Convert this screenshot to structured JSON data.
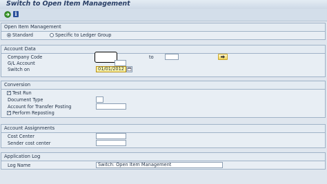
{
  "window": {
    "title": "Switch to Open Item Management"
  },
  "toolbar": {
    "execute_icon": "execute-icon",
    "info_label": "i"
  },
  "open_item_management": {
    "title": "Open Item Management",
    "options": [
      {
        "label": "Standard",
        "selected": true
      },
      {
        "label": "Specific to Ledger Group",
        "selected": false
      }
    ]
  },
  "account_data": {
    "title": "Account Data",
    "company_code_label": "Company Code",
    "company_code_value": "",
    "to_label": "to",
    "to_value": "",
    "gl_account_label": "G/L Account",
    "gl_account_value": "",
    "switch_on_label": "Switch on",
    "switch_on_value": "01/01/2012"
  },
  "conversion": {
    "title": "Conversion",
    "test_run_label": "Test Run",
    "test_run_checked": true,
    "document_type_label": "Document Type",
    "document_type_value": "",
    "transfer_account_label": "Account for Transfer Posting",
    "transfer_account_value": "",
    "perform_reposting_label": "Perform Reposting",
    "perform_reposting_checked": true,
    "check_mark": "✓"
  },
  "account_assignments": {
    "title": "Account Assignments",
    "cost_center_label": "Cost Center",
    "cost_center_value": "",
    "sender_cost_center_label": "Sender cost center",
    "sender_cost_center_value": ""
  },
  "application_log": {
    "title": "Application Log",
    "log_name_label": "Log Name",
    "log_name_value": "Switch: Open Item Management"
  },
  "colors": {
    "background": "#dfe6ee",
    "frame_border": "#9fb2c7",
    "date_field": "#fff6a8",
    "title_text": "#2a3f66"
  }
}
